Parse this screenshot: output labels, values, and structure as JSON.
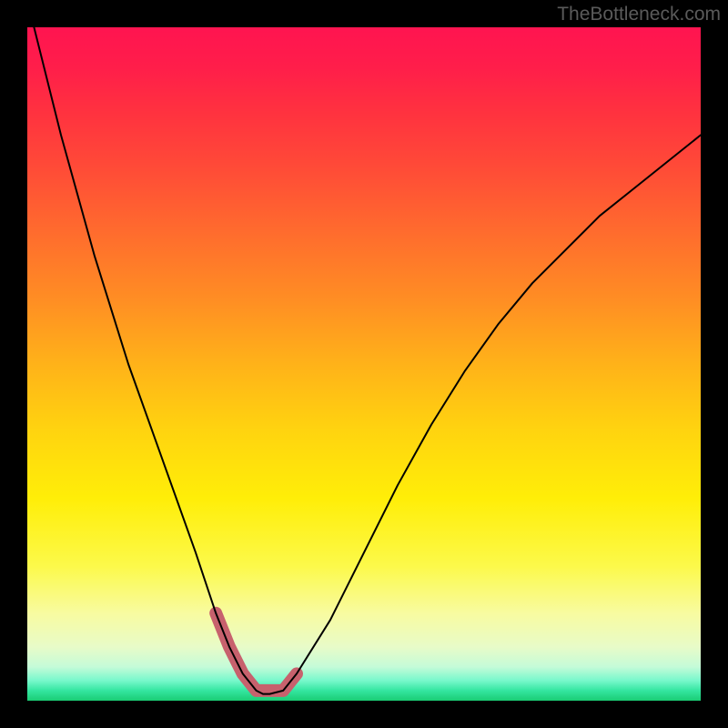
{
  "watermark": "TheBottleneck.com",
  "chart_data": {
    "type": "line",
    "title": "",
    "xlabel": "",
    "ylabel": "",
    "xlim": [
      0,
      100
    ],
    "ylim": [
      0,
      100
    ],
    "grid": false,
    "legend": false,
    "series": [
      {
        "name": "bottleneck-curve",
        "x": [
          1,
          5,
          10,
          15,
          20,
          25,
          28,
          30,
          32,
          34,
          35,
          36,
          38,
          40,
          45,
          50,
          55,
          60,
          65,
          70,
          75,
          80,
          85,
          90,
          95,
          100
        ],
        "y": [
          100,
          84,
          66,
          50,
          36,
          22,
          13,
          8,
          4,
          1.5,
          1,
          1,
          1.5,
          4,
          12,
          22,
          32,
          41,
          49,
          56,
          62,
          67,
          72,
          76,
          80,
          84
        ]
      }
    ],
    "highlight": {
      "name": "near-minimum-band",
      "x": [
        28,
        30,
        32,
        34,
        36,
        38,
        40
      ],
      "y": [
        13,
        8,
        4,
        1.5,
        1.5,
        1.5,
        4
      ],
      "color": "#c7616d",
      "stroke_width": 14
    },
    "background_gradient": {
      "top": "#ff1450",
      "mid": "#ffd40f",
      "bottom": "#1acc74"
    }
  }
}
